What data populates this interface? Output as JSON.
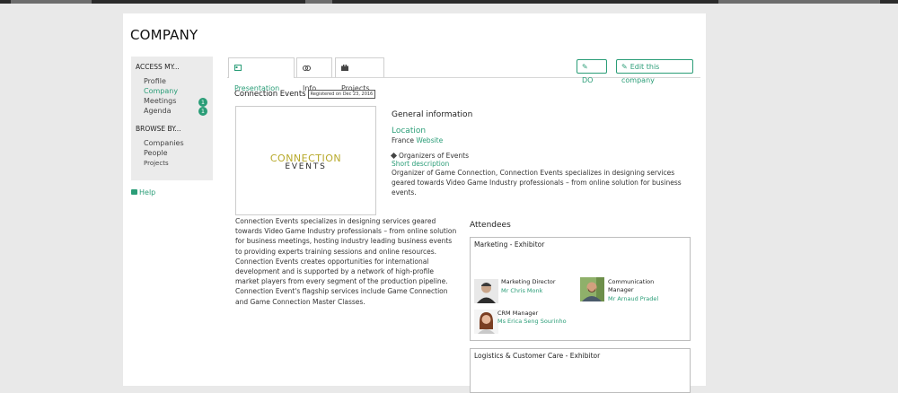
{
  "page": {
    "title": "COMPANY"
  },
  "sidebar": {
    "access_heading": "ACCESS MY...",
    "access_items": [
      {
        "label": "Profile"
      },
      {
        "label": "Company"
      },
      {
        "label": "Meetings",
        "badge": "1"
      },
      {
        "label": "Agenda",
        "badge": "1"
      }
    ],
    "browse_heading": "BROWSE BY...",
    "browse_items": [
      {
        "label": "Companies"
      },
      {
        "label": "People"
      },
      {
        "label": "Projects"
      }
    ],
    "help_label": "Help"
  },
  "tabs": [
    {
      "label": "Presentation",
      "icon": "id-card-icon",
      "active": true
    },
    {
      "label": "Info",
      "icon": "link-icon"
    },
    {
      "label": "Projects",
      "icon": "briefcase-icon"
    }
  ],
  "actions": {
    "do_label": "DO",
    "edit_label": "Edit this company"
  },
  "company": {
    "name": "Connection Events",
    "registered": "Registered on Dec 23, 2016",
    "logo_line1": "CONNECTION",
    "logo_line2": "EVENTS",
    "description": "Connection Events specializes in designing services geared towards Video Game Industry professionals – from online solution for business meetings, hosting industry leading business events to providing experts training sessions and online resources. Connection Events creates opportunities for international development and is supported by a network of high-profile market players from every segment of the production pipeline. Connection Event's flagship services include Game Connection and Game Connection Master Classes."
  },
  "general_info": {
    "title": "General information",
    "location_heading": "Location",
    "country": "France",
    "website_label": "Website",
    "tag": "Organizers of Events",
    "short_desc_heading": "Short description",
    "short_desc": "Organizer of Game Connection, Connection Events specializes in designing services geared towards Video Game Industry professionals – from online solution for business events."
  },
  "attendees": {
    "title": "Attendees",
    "groups": [
      {
        "title": "Marketing - Exhibitor",
        "people": [
          {
            "role": "Marketing Director",
            "name": "Mr Chris Monk"
          },
          {
            "role": "Communication Manager",
            "name": "Mr Arnaud Pradel"
          },
          {
            "role": "CRM Manager",
            "name": "Ms Erica Seng Sourinho"
          }
        ]
      },
      {
        "title": "Logistics & Customer Care - Exhibitor",
        "people": []
      }
    ]
  },
  "colors": {
    "accent": "#2a9d77",
    "sidebar_bg": "#ebebeb",
    "page_bg": "#e9e9e9"
  }
}
